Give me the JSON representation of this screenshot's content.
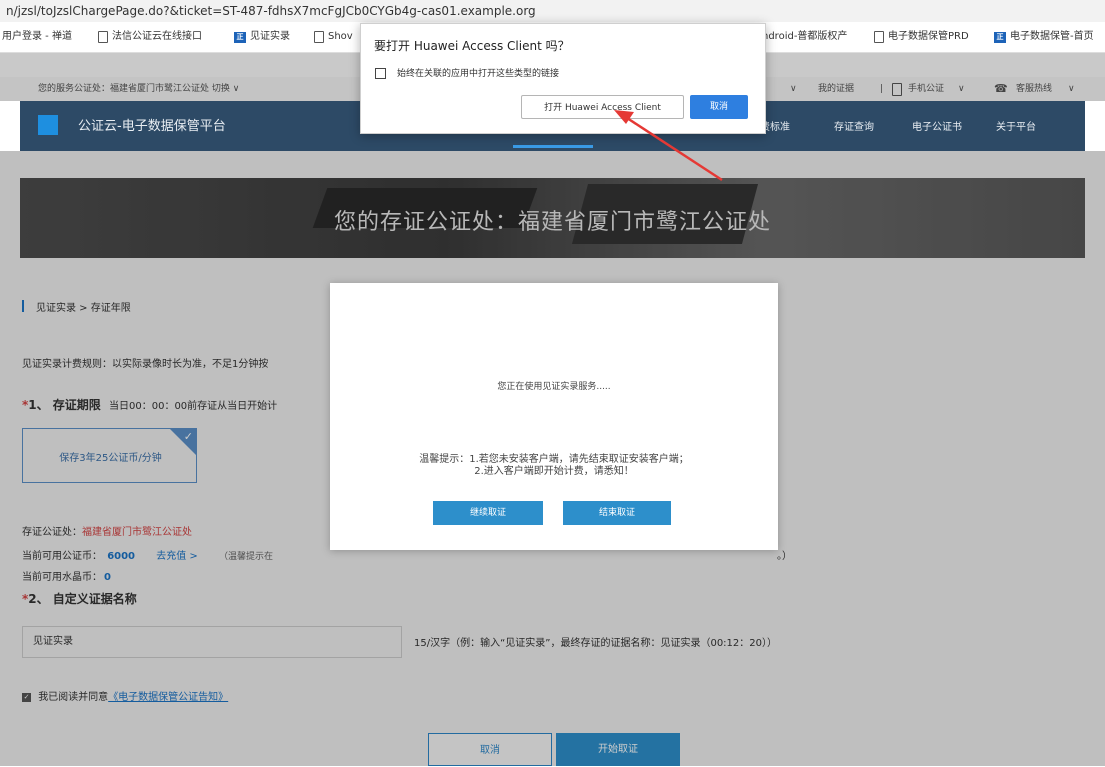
{
  "browser": {
    "url": "n/jzsl/toJzslChargePage.do?&ticket=ST-487-fdhsX7mcFgJCb0CYGb4g-cas01.example.org",
    "bookmarks": [
      {
        "label": "用户登录 - 禅道"
      },
      {
        "label": "法信公证云在线接口"
      },
      {
        "label": "见证实录"
      },
      {
        "label": "Shov"
      },
      {
        "label": "ndroid-普都版权产"
      },
      {
        "label": "电子数据保管PRD"
      },
      {
        "label": "电子数据保管-首页"
      }
    ]
  },
  "external_dialog": {
    "title": "要打开 Huawei Access Client 吗？",
    "checkbox_label": "始终在关联的应用中打开这些类型的链接",
    "open_label": "打开 Huawei Access Client",
    "cancel_label": "取消"
  },
  "service_bar": {
    "left_text": "您的服务公证处：福建省厦门市鹭江公证处 切换 ∨",
    "my_cert": "我的证据",
    "mobile": "手机公证",
    "hotline": "客服热线"
  },
  "nav": {
    "title": "公证云-电子数据保管平台",
    "links": [
      "费标准",
      "存证查询",
      "电子公证书",
      "关于平台"
    ]
  },
  "banner": {
    "text": "您的存证公证处：福建省厦门市鹭江公证处"
  },
  "breadcrumb": "见证实录 > 存证年限",
  "billing_rule": "见证实录计费规则：以实际录像时长为准，不足1分钟按",
  "section1": {
    "title": "1、 存证期限",
    "note": "当日00：00：00前存证从当日开始计",
    "option_label": "保存3年25公证币/分钟"
  },
  "info": {
    "notary_label": "存证公证处：",
    "notary_value": "福建省厦门市鹭江公证处",
    "coins_label": "当前可用公证币：",
    "coins_value": "6000",
    "recharge": "去充值 >",
    "hint": "（温馨提示在",
    "hint_end": "。）",
    "crystal_label": "当前可用水晶币：",
    "crystal_value": "0"
  },
  "section2": {
    "title": "2、 自定义证据名称",
    "input_value": "见证实录",
    "hint": "15/汉字（例：输入“见证实录”，最终存证的证据名称：见证实录（00:12：20））"
  },
  "agree": {
    "prefix": "我已阅读并同意",
    "link": "《电子数据保管公证告知》"
  },
  "bottom_buttons": {
    "cancel": "取消",
    "start": "开始取证"
  },
  "modal": {
    "status": "您正在使用见证实录服务.....",
    "tip_line1": "温馨提示：1.若您未安装客户端，请先结束取证安装客户端；",
    "tip_line2": "2.进入客户端即开始计费，请悉知！",
    "continue_label": "继续取证",
    "end_label": "结束取证"
  }
}
